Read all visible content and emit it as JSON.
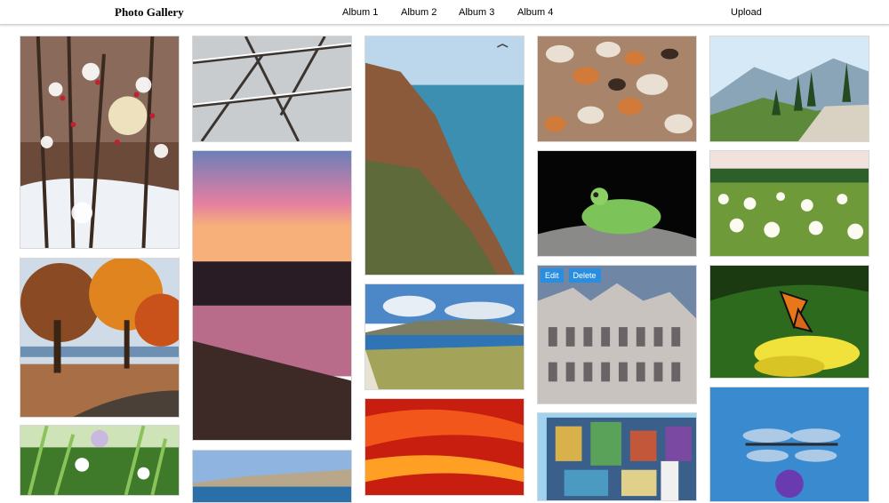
{
  "header": {
    "brand": "Photo Gallery",
    "nav": [
      "Album 1",
      "Album 2",
      "Album 3",
      "Album 4"
    ],
    "upload_label": "Upload"
  },
  "gallery": {
    "hovered_tile_actions": {
      "edit_label": "Edit",
      "delete_label": "Delete"
    },
    "photos": [
      "winter sunlight through snowy berry tree",
      "autumn trees with orange foliage in park",
      "wildflowers close-up",
      "snowy branches",
      "pink sunset over lake",
      "coastal town across blue water",
      "coastal cliffs and turquoise sea",
      "bay view with hills and beach grass",
      "fiery red sunset clouds",
      "pile of seashells",
      "green tree frog on branch",
      "ornate historic building facade",
      "mosaic mural wall",
      "mountain valley path",
      "meadow of white flowers",
      "monarch butterfly on yellow flowers",
      "dragonfly on purple flower"
    ]
  }
}
